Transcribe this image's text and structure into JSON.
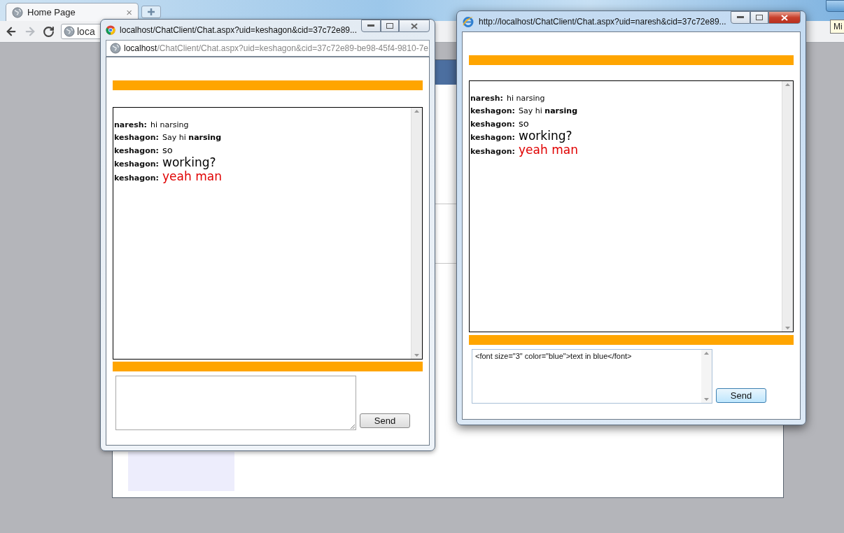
{
  "browser": {
    "tab": {
      "title": "Home Page",
      "close": "×"
    },
    "address": "loca",
    "tooltip": "Mi"
  },
  "windows": [
    {
      "kind": "chrome",
      "active": false,
      "title": "localhost/ChatClient/Chat.aspx?uid=keshagon&cid=37c72e89...",
      "address": {
        "host": "localhost",
        "path": "/ChatClient/Chat.aspx?uid=keshagon&cid=37c72e89-be98-45f4-9810-7e"
      },
      "messages": [
        {
          "sender": "naresh:",
          "text": "hi narsing",
          "kind": "small",
          "color": "#000000"
        },
        {
          "sender": "keshagon:",
          "text": "Say hi **narsing**",
          "kind": "small",
          "color": "#000000"
        },
        {
          "sender": "keshagon:",
          "text": "so",
          "kind": "medium",
          "color": "#000000"
        },
        {
          "sender": "keshagon:",
          "text": "working?",
          "kind": "large",
          "color": "#000000"
        },
        {
          "sender": "keshagon:",
          "text": "yeah man",
          "kind": "large",
          "color": "#e00000"
        }
      ],
      "send": "Send"
    },
    {
      "kind": "ie",
      "active": true,
      "title": "http://localhost/ChatClient/Chat.aspx?uid=naresh&cid=37c72e89...",
      "messages": [
        {
          "sender": "naresh:",
          "text": "hi narsing",
          "kind": "small",
          "color": "#000000"
        },
        {
          "sender": "keshagon:",
          "text": "Say hi **narsing**",
          "kind": "small",
          "color": "#000000"
        },
        {
          "sender": "keshagon:",
          "text": "so",
          "kind": "medium",
          "color": "#000000"
        },
        {
          "sender": "keshagon:",
          "text": "working?",
          "kind": "large",
          "color": "#000000"
        },
        {
          "sender": "keshagon:",
          "text": "yeah man",
          "kind": "large",
          "color": "#e00000"
        }
      ],
      "input": {
        "value": "<font size=\"3\" color=\"blue\">text in blue</font>"
      },
      "send": "Send"
    }
  ]
}
